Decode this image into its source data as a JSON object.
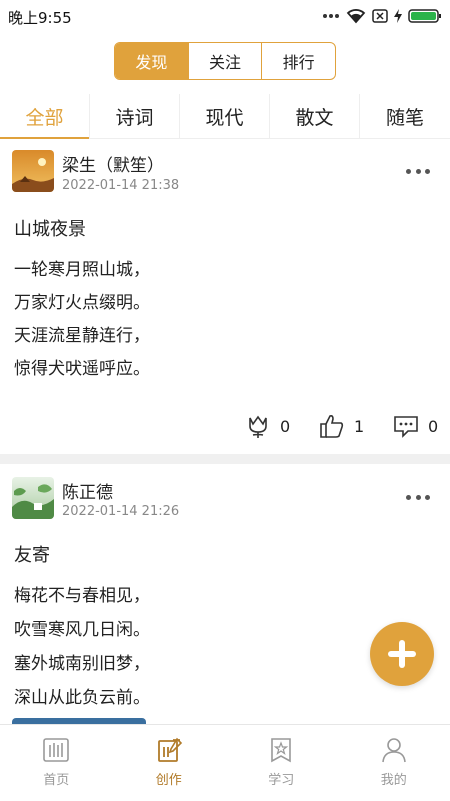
{
  "status": {
    "time": "晚上9:55"
  },
  "segment": {
    "tabs": [
      "发现",
      "关注",
      "排行"
    ]
  },
  "categories": [
    "全部",
    "诗词",
    "现代",
    "散文",
    "随笔"
  ],
  "posts": [
    {
      "author": "梁生（默笙）",
      "date": "2022-01-14 21:38",
      "title": "山城夜景",
      "lines": [
        "一轮寒月照山城，",
        "万家灯火点缀明。",
        "天涯流星静连行，",
        "惊得犬吠遥呼应。"
      ],
      "likes_flower": "0",
      "likes_thumb": "1",
      "comments": "0"
    },
    {
      "author": "陈正德",
      "date": "2022-01-14 21:26",
      "title": "友寄",
      "lines": [
        "梅花不与春相见，",
        "吹雪寒风几日闲。",
        "塞外城南别旧梦，",
        "深山从此负云前。"
      ]
    }
  ],
  "bottom_nav": [
    "首页",
    "创作",
    "学习",
    "我的"
  ],
  "colors": {
    "accent": "#e0a23c"
  }
}
